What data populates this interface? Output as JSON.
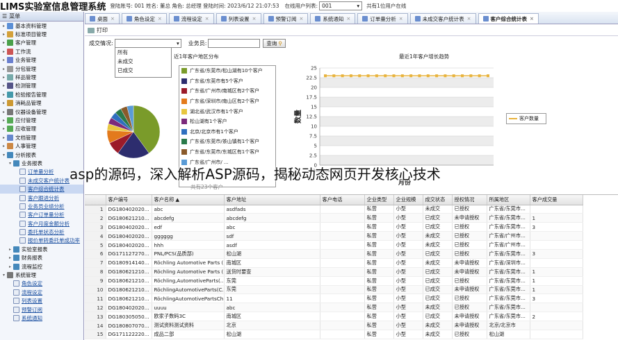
{
  "header": {
    "title": "LIMS实验室信息管理系统",
    "user_info": "登陆账号: 001 姓名: 董总 角色: 总经理 登陆时间: 2023/6/12 21:07:53",
    "online_label": "在线用户列表:",
    "online_value": "001",
    "online_count": "共有1位用户在线"
  },
  "sidebar": {
    "title": "菜单",
    "items": [
      {
        "label": "基本资料管理",
        "level": 0,
        "color": "#5b8fd6",
        "sub": false
      },
      {
        "label": "标准项目管理",
        "level": 0,
        "color": "#d4a13a",
        "sub": false
      },
      {
        "label": "客户管理",
        "level": 0,
        "color": "#4aa04a",
        "sub": false
      },
      {
        "label": "工作流",
        "level": 0,
        "color": "#c55",
        "sub": false
      },
      {
        "label": "业务管理",
        "level": 0,
        "color": "#6a7fcf",
        "sub": false
      },
      {
        "label": "分包管理",
        "level": 0,
        "color": "#999",
        "sub": false
      },
      {
        "label": "样品管理",
        "level": 0,
        "color": "#7aa",
        "sub": false
      },
      {
        "label": "检测管理",
        "level": 0,
        "color": "#558",
        "sub": false
      },
      {
        "label": "检验报告管理",
        "level": 0,
        "color": "#49a",
        "sub": false
      },
      {
        "label": "消耗品管理",
        "level": 0,
        "color": "#c93",
        "sub": false
      },
      {
        "label": "仪器设备管理",
        "level": 0,
        "color": "#777",
        "sub": false
      },
      {
        "label": "应付管理",
        "level": 0,
        "color": "#5a5",
        "sub": false
      },
      {
        "label": "应收管理",
        "level": 0,
        "color": "#5a5",
        "sub": false
      },
      {
        "label": "文档管理",
        "level": 0,
        "color": "#68c",
        "sub": false
      },
      {
        "label": "人事管理",
        "level": 0,
        "color": "#c84",
        "sub": false
      },
      {
        "label": "分析报表",
        "level": 0,
        "color": "#48b",
        "sub": false,
        "expanded": true
      },
      {
        "label": "业务报表",
        "level": 1,
        "color": "#48b",
        "sub": false,
        "expanded": true
      },
      {
        "label": "订单量分析",
        "level": 2,
        "sub": true
      },
      {
        "label": "未成交客户统计表",
        "level": 2,
        "sub": true
      },
      {
        "label": "客户综合统计表",
        "level": 2,
        "sub": true,
        "active": true
      },
      {
        "label": "客户跟进分析",
        "level": 2,
        "sub": true
      },
      {
        "label": "业务员业绩分析",
        "level": 2,
        "sub": true
      },
      {
        "label": "客户订单量分析",
        "level": 2,
        "sub": true
      },
      {
        "label": "客户月度金额分析",
        "level": 2,
        "sub": true
      },
      {
        "label": "委托单状态分析",
        "level": 2,
        "sub": true
      },
      {
        "label": "报价单转委托单成功率",
        "level": 2,
        "sub": true
      },
      {
        "label": "实验室报表",
        "level": 1,
        "color": "#48b",
        "sub": false
      },
      {
        "label": "财务报表",
        "level": 1,
        "color": "#48b",
        "sub": false
      },
      {
        "label": "流程监控",
        "level": 1,
        "color": "#48b",
        "sub": false
      },
      {
        "label": "系统管理",
        "level": 0,
        "color": "#777",
        "sub": false,
        "expanded": true
      },
      {
        "label": "角色设定",
        "level": 1,
        "sub": true
      },
      {
        "label": "流程设定",
        "level": 1,
        "sub": true
      },
      {
        "label": "列表设置",
        "level": 1,
        "sub": true
      },
      {
        "label": "预警订阅",
        "level": 1,
        "sub": true
      },
      {
        "label": "系统通知",
        "level": 1,
        "sub": true
      }
    ]
  },
  "tabs": [
    {
      "label": "桌面",
      "active": false
    },
    {
      "label": "角色设定",
      "active": false
    },
    {
      "label": "流程设定",
      "active": false
    },
    {
      "label": "列表设置",
      "active": false
    },
    {
      "label": "预警订阅",
      "active": false
    },
    {
      "label": "系统通知",
      "active": false
    },
    {
      "label": "订单量分析",
      "active": false
    },
    {
      "label": "未成交客户统计表",
      "active": false
    },
    {
      "label": "客户综合统计表",
      "active": true
    }
  ],
  "toolbar": {
    "print_label": "打印"
  },
  "filter": {
    "deal_label": "成交情况:",
    "sales_label": "业务员:",
    "search_label": "查询",
    "options": [
      "所有",
      "未成交",
      "已成交"
    ]
  },
  "overlay_text": "asp的源码，深入解析ASP源码，揭秘动态网页开发核心技术",
  "chart_data": [
    {
      "type": "pie",
      "title": "近1年客户地区分布",
      "slices": [
        {
          "label": "广东省/东莞市/松山湖有10个客户",
          "value": 10,
          "color": "#7a9b2a"
        },
        {
          "label": "广东省/东莞市有5个客户",
          "value": 5,
          "color": "#2d2d6e"
        },
        {
          "label": "广东省/广州市/南城区有2个客户",
          "value": 2,
          "color": "#9b1b2a"
        },
        {
          "label": "广东省/深圳市/南山区有2个客户",
          "value": 2,
          "color": "#e37a1c"
        },
        {
          "label": "湖北省/武汉市有1个客户",
          "value": 1,
          "color": "#e8c640"
        },
        {
          "label": "松山湖有1个客户",
          "value": 1,
          "color": "#7b2a7b"
        },
        {
          "label": "北京/北京市有1个客户",
          "value": 1,
          "color": "#2f6fbf"
        },
        {
          "label": "广东省/东莞市/茶山镇有1个客户",
          "value": 1,
          "color": "#2a7a4a"
        },
        {
          "label": "广东省/东莞市/东城区有1个客户",
          "value": 1,
          "color": "#8a5a2a"
        },
        {
          "label": "广东省/广州市/ ...",
          "value": 1,
          "color": "#5a9bd6"
        }
      ],
      "footer": "共有23个客户"
    },
    {
      "type": "line",
      "title": "最近1年客户增长趋势",
      "ylabel": "数量",
      "xlabel": "月份",
      "ylim": [
        0,
        25
      ],
      "yticks": [
        0,
        2.5,
        5,
        7.5,
        10,
        12.5,
        15,
        17.5,
        20,
        22.5,
        25
      ],
      "grid": true,
      "legend": "right",
      "x_first_label": "2022-06",
      "series": [
        {
          "name": "客户数量",
          "color": "#e8b23a",
          "values": [
            23,
            23,
            23,
            23,
            23,
            23,
            23,
            23,
            23,
            23,
            23,
            23,
            23,
            23,
            23,
            23,
            23,
            23,
            23,
            23
          ]
        }
      ]
    }
  ],
  "table": {
    "columns": [
      "",
      "客户编号",
      "客户名称 ▲",
      "客户地址",
      "客户电话",
      "企业类型",
      "企业规模",
      "成交状态",
      "授权情况",
      "所属地区",
      "客户成交量"
    ],
    "rows": [
      [
        "1",
        "DG180402020...",
        "abc",
        "asdfads",
        "",
        "私营",
        "小型",
        "未成交",
        "已授权",
        "广东省/东莞市...",
        ""
      ],
      [
        "2",
        "DG180621210...",
        "abcdefg",
        "abcdefg",
        "",
        "私营",
        "小型",
        "已成交",
        "未申请授权",
        "广东省/东莞市...",
        "1"
      ],
      [
        "3",
        "DG180402020...",
        "edf",
        "abc",
        "",
        "私营",
        "小型",
        "已成交",
        "已授权",
        "广东省/东莞市...",
        "3"
      ],
      [
        "4",
        "DG180402020...",
        "gggggg",
        "sdf",
        "",
        "私营",
        "小型",
        "未成交",
        "已授权",
        "广东省/广州市...",
        ""
      ],
      [
        "5",
        "DG180402020...",
        "hhh",
        "asdf",
        "",
        "私营",
        "小型",
        "未成交",
        "已授权",
        "广东省/广州市...",
        ""
      ],
      [
        "6",
        "DG171127270...",
        "PNL/PCS(品质部)",
        "松山湖",
        "",
        "私营",
        "小型",
        "已成交",
        "已授权",
        "广东省/东莞市...",
        "3"
      ],
      [
        "7",
        "DG180914140...",
        "Röchling Automotive Parts (...",
        "南城区",
        "",
        "私营",
        "小型",
        "未成交",
        "未申请授权",
        "广东省/深圳市...",
        ""
      ],
      [
        "8",
        "DG180621210...",
        "Röchling Automotive Parts (...",
        "送货时要查",
        "",
        "私营",
        "小型",
        "已成交",
        "未申请授权",
        "广东省/东莞市...",
        "1"
      ],
      [
        "9",
        "DG180621210...",
        "Röchling,AutomotiveParts(...",
        "东莞",
        "",
        "私营",
        "小型",
        "已成交",
        "已授权",
        "广东省/东莞市...",
        "1"
      ],
      [
        "10",
        "DG180621210...",
        "RöchlingAutomotiveParts(C...",
        "东莞",
        "",
        "私营",
        "小型",
        "已成交",
        "未申请授权",
        "广东省/东莞市...",
        "1"
      ],
      [
        "11",
        "DG180621210...",
        "RöchlingAutomotivePartsCh...",
        "11",
        "",
        "私营",
        "小型",
        "已成交",
        "已授权",
        "广东省/东莞市...",
        "3"
      ],
      [
        "12",
        "DG180402020...",
        "uuuu",
        "abc",
        "",
        "私营",
        "小型",
        "未成交",
        "已授权",
        "广东省/东莞市...",
        ""
      ],
      [
        "13",
        "DG180305050...",
        "欧家子数码3C",
        "南城区",
        "",
        "私营",
        "小型",
        "已成交",
        "未申请授权",
        "广东省/东莞市...",
        "2"
      ],
      [
        "14",
        "DG180807070...",
        "测试资料测试资料",
        "北京",
        "",
        "私营",
        "小型",
        "未成交",
        "未申请授权",
        "北京/北京市",
        ""
      ],
      [
        "15",
        "DG171122220...",
        "成品二部",
        "松山湖",
        "",
        "私营",
        "小型",
        "未成交",
        "已授权",
        "松山湖",
        ""
      ]
    ]
  }
}
